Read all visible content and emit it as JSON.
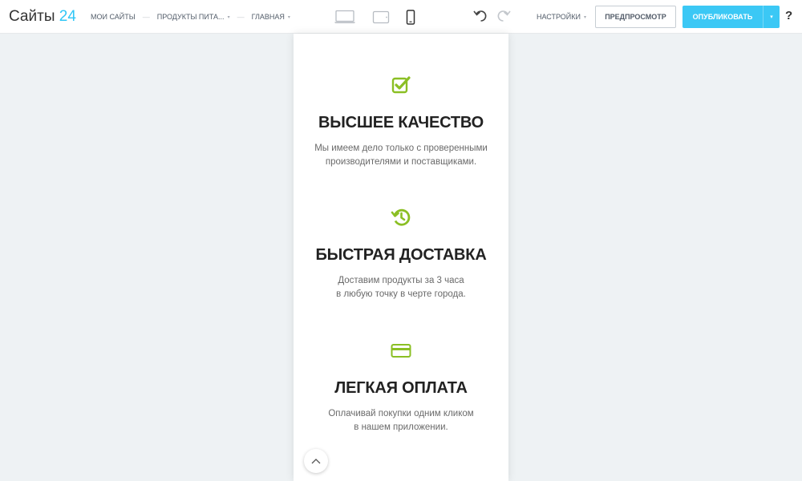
{
  "header": {
    "logo_text": "Сайты",
    "logo_number": "24",
    "breadcrumbs": [
      {
        "label": "МОИ САЙТЫ"
      },
      {
        "label": "ПРОДУКТЫ ПИТА..."
      },
      {
        "label": "ГЛАВНАЯ"
      }
    ],
    "breadcrumb_separator": "—",
    "caret": "▾",
    "devices": [
      {
        "icon": "laptop-icon",
        "state": "inactive"
      },
      {
        "icon": "tablet-icon",
        "state": "inactive"
      },
      {
        "icon": "phone-icon",
        "state": "active"
      }
    ],
    "settings_label": "НАСТРОЙКИ",
    "preview_label": "ПРЕДПРОСМОТР",
    "publish_label": "ОПУБЛИКОВАТЬ",
    "publish_arrow": "▾",
    "help_label": "?"
  },
  "content": {
    "features": [
      {
        "icon": "check-square-icon",
        "title": "ВЫСШЕЕ КАЧЕСТВО",
        "desc_line1": "Мы имеем дело только с проверенными",
        "desc_line2": "производителями и поставщиками."
      },
      {
        "icon": "history-clock-icon",
        "title": "БЫСТРАЯ ДОСТАВКА",
        "desc_line1": "Доставим продукты за 3 часа",
        "desc_line2": "в любую точку в черте города."
      },
      {
        "icon": "credit-card-icon",
        "title": "ЛЕГКАЯ ОПЛАТА",
        "desc_line1": "Оплачивай покупки одним кликом",
        "desc_line2": "в нашем приложении."
      }
    ]
  },
  "colors": {
    "accent_blue": "#2fc6f6",
    "publish_button": "#3bc8f5",
    "icon_green": "#8bbf24",
    "canvas_background": "#eef2f4"
  }
}
